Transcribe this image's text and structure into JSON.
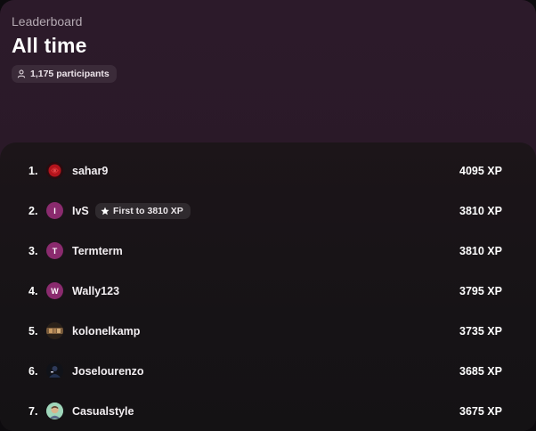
{
  "header": {
    "kicker": "Leaderboard",
    "title": "All time",
    "participants": "1,175 participants"
  },
  "rows": [
    {
      "rank": "1.",
      "avatar_letter": "",
      "avatar_icon": "rose-avatar",
      "username": "sahar9",
      "badge": "",
      "xp": "4095 XP"
    },
    {
      "rank": "2.",
      "avatar_letter": "I",
      "avatar_color": "#8a2b6e",
      "username": "IvS",
      "badge": "First to 3810 XP",
      "xp": "3810 XP"
    },
    {
      "rank": "3.",
      "avatar_letter": "T",
      "avatar_color": "#8a2b6e",
      "username": "Termterm",
      "badge": "",
      "xp": "3810 XP"
    },
    {
      "rank": "4.",
      "avatar_letter": "W",
      "avatar_color": "#8a2b6e",
      "username": "Wally123",
      "badge": "",
      "xp": "3795 XP"
    },
    {
      "rank": "5.",
      "avatar_letter": "",
      "avatar_icon": "photo-avatar",
      "username": "kolonelkamp",
      "badge": "",
      "xp": "3735 XP"
    },
    {
      "rank": "6.",
      "avatar_letter": "",
      "avatar_icon": "dark-avatar",
      "username": "Joselourenzo",
      "badge": "",
      "xp": "3685 XP"
    },
    {
      "rank": "7.",
      "avatar_letter": "",
      "avatar_icon": "face-avatar",
      "username": "Casualstyle",
      "badge": "",
      "xp": "3675 XP"
    }
  ],
  "colors": {
    "accent_avatar": "#8a2b6e",
    "header_bg": "#2c1a2a",
    "panel_bg": "#161316"
  }
}
